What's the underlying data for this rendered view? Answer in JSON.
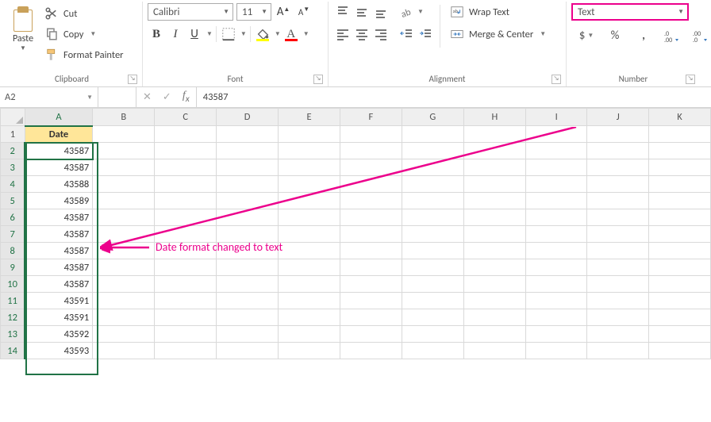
{
  "ribbon": {
    "clipboard": {
      "paste": "Paste",
      "cut": "Cut",
      "copy": "Copy",
      "format_painter": "Format Painter",
      "group_label": "Clipboard"
    },
    "font": {
      "name": "Calibri",
      "size": "11",
      "inc_A": "A",
      "dec_A": "A",
      "bold": "B",
      "italic": "I",
      "underline": "U",
      "fill_color": "#ffff00",
      "font_color": "#ff0000",
      "group_label": "Font"
    },
    "alignment": {
      "wrap": "Wrap Text",
      "merge": "Merge & Center",
      "group_label": "Alignment"
    },
    "number": {
      "format": "Text",
      "dollar": "$",
      "percent": "%",
      "comma": ",",
      "inc_dec": ".0",
      "group_label": "Number"
    }
  },
  "namebox": "A2",
  "formula_value": "43587",
  "columns": [
    "A",
    "B",
    "C",
    "D",
    "E",
    "F",
    "G",
    "H",
    "I",
    "J",
    "K"
  ],
  "rows": [
    {
      "n": 1,
      "hdr": true,
      "v": "Date"
    },
    {
      "n": 2,
      "v": "43587",
      "active": true
    },
    {
      "n": 3,
      "v": "43587"
    },
    {
      "n": 4,
      "v": "43588"
    },
    {
      "n": 5,
      "v": "43589"
    },
    {
      "n": 6,
      "v": "43587"
    },
    {
      "n": 7,
      "v": "43587"
    },
    {
      "n": 8,
      "v": "43587"
    },
    {
      "n": 9,
      "v": "43587"
    },
    {
      "n": 10,
      "v": "43587"
    },
    {
      "n": 11,
      "v": "43591"
    },
    {
      "n": 12,
      "v": "43591"
    },
    {
      "n": 13,
      "v": "43592"
    },
    {
      "n": 14,
      "v": "43593"
    }
  ],
  "annotation": "Date format changed to text"
}
